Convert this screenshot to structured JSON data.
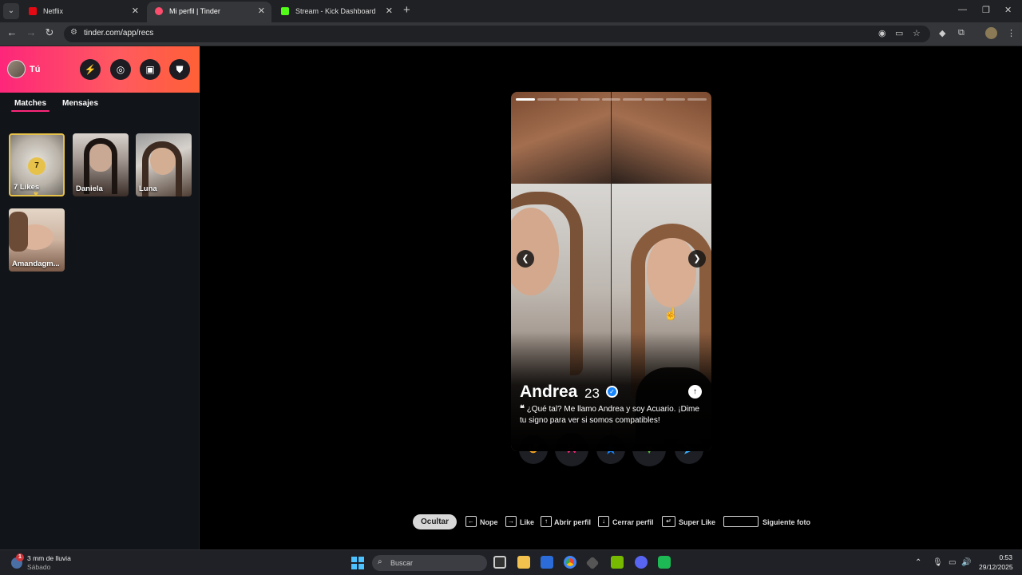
{
  "browser": {
    "tabs": [
      {
        "title": "Netflix",
        "active": false,
        "favicon_color": "#e50914"
      },
      {
        "title": "Mi perfil | Tinder",
        "active": true,
        "favicon_color": "#fd4d6d"
      },
      {
        "title": "Stream - Kick Dashboard",
        "active": false,
        "favicon_color": "#53fc18"
      }
    ],
    "url": "tinder.com/app/recs"
  },
  "sidebar": {
    "user_label": "Tú",
    "tabs": [
      "Matches",
      "Mensajes"
    ],
    "likes_card": {
      "count": "7",
      "label": "7 Likes"
    },
    "matches": [
      {
        "name": "Daniela"
      },
      {
        "name": "Luna"
      },
      {
        "name": "Amandagm..."
      }
    ]
  },
  "profile": {
    "name": "Andrea",
    "age": "23",
    "bio_quote": "❝",
    "bio": "¿Qué tal? Me llamo Andrea y soy Acuario. ¡Dime tu signo para ver si somos compatibles!",
    "photo_count": 9,
    "active_photo": 0
  },
  "actions": [
    {
      "name": "rewind",
      "glyph": "↺",
      "color": "#f5a524"
    },
    {
      "name": "nope",
      "glyph": "✕",
      "color": "#fd267a"
    },
    {
      "name": "super-like",
      "glyph": "★",
      "color": "#1786ff"
    },
    {
      "name": "like",
      "glyph": "♥",
      "color": "#5fcc3a"
    },
    {
      "name": "boost",
      "glyph": "➤",
      "color": "#3ab0ff"
    }
  ],
  "shortcuts": {
    "hide": "Ocultar",
    "items": [
      {
        "key": "←",
        "label": "Nope"
      },
      {
        "key": "→",
        "label": "Like"
      },
      {
        "key": "↑",
        "label": "Abrir perfil"
      },
      {
        "key": "↓",
        "label": "Cerrar perfil"
      },
      {
        "key": "↵",
        "label": "Super Like"
      },
      {
        "key": "",
        "label": "Siguiente foto"
      }
    ]
  },
  "taskbar": {
    "weather_line1": "3 mm de lluvia",
    "weather_line2": "Sábado",
    "weather_badge": "1",
    "search_placeholder": "Buscar",
    "time": "0:53",
    "date": "29/12/2025"
  }
}
